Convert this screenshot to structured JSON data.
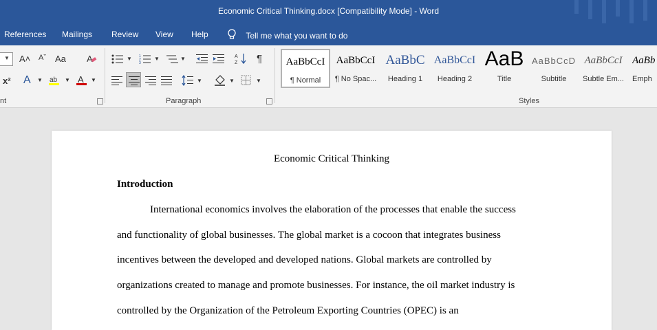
{
  "window": {
    "title": "Economic Critical Thinking.docx [Compatibility Mode]  -  Word"
  },
  "menu": {
    "tabs": [
      "References",
      "Mailings",
      "Review",
      "View",
      "Help"
    ],
    "tell_me": "Tell me what you want to do"
  },
  "ribbon": {
    "font_group_label": "nt",
    "paragraph_group_label": "Paragraph",
    "styles_group_label": "Styles",
    "grow_font": "A˄",
    "change_case": "Aa",
    "superscript": "x²",
    "styles": [
      {
        "preview": "AaBbCcI",
        "name": "¶ Normal",
        "selected": true
      },
      {
        "preview": "AaBbCcI",
        "name": "¶ No Spac..."
      },
      {
        "preview": "AaBbC",
        "name": "Heading 1"
      },
      {
        "preview": "AaBbCcI",
        "name": "Heading 2"
      },
      {
        "preview": "AaB",
        "name": "Title"
      },
      {
        "preview": "AaBbCcD",
        "name": "Subtitle"
      },
      {
        "preview": "AaBbCcI",
        "name": "Subtle Em..."
      },
      {
        "preview": "AaBb",
        "name": "Emph"
      }
    ]
  },
  "document": {
    "title": "Economic Critical Thinking",
    "heading": "Introduction",
    "lines": [
      "International economics involves the elaboration of the processes that enable the success",
      "and functionality of global businesses. The global market is a cocoon that integrates business",
      "incentives between the developed and developed nations. Global markets are controlled by",
      "organizations created to manage and promote businesses. For instance, the oil market industry is",
      "controlled by the Organization of the Petroleum Exporting Countries (OPEC) is an"
    ]
  },
  "colors": {
    "accent": "#2b579a",
    "ribbon_bg": "#f3f3f3",
    "canvas_bg": "#e6e6e6",
    "heading_blue": "#2f5597"
  }
}
